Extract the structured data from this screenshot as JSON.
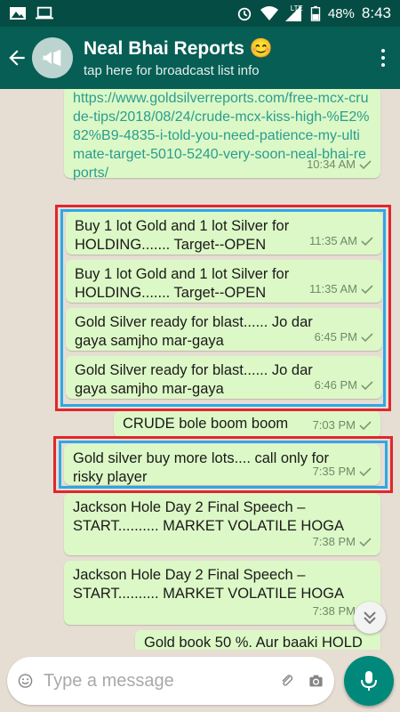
{
  "status_bar": {
    "battery": "48%",
    "time": "8:43",
    "network": "LTE"
  },
  "header": {
    "title": "Neal Bhai Reports 😊",
    "subtitle": "tap here for broadcast list info"
  },
  "messages": [
    {
      "text": "https://www.goldsilverreports.com/free-mcx-crude-tips/2018/08/24/crude-mcx-kiss-high-%E2%82%B9-4835-i-told-you-need-patience-my-ultimate-target-5010-5240-very-soon-neal-bhai-reports/",
      "time": "10:34 AM"
    },
    {
      "text": "Buy 1 lot Gold and 1 lot Silver for HOLDING....... Target--OPEN",
      "time": "11:35 AM"
    },
    {
      "text": "Buy 1 lot Gold and 1 lot Silver for HOLDING....... Target--OPEN",
      "time": "11:35 AM"
    },
    {
      "text": "Gold Silver ready for blast...... Jo dar gaya samjho mar-gaya",
      "time": "6:45 PM"
    },
    {
      "text": "Gold Silver ready for blast...... Jo dar gaya samjho mar-gaya",
      "time": "6:46 PM"
    },
    {
      "text": "CRUDE bole boom boom",
      "time": "7:03 PM"
    },
    {
      "text": "Gold silver buy more lots.... call only for risky player",
      "time": "7:35 PM"
    },
    {
      "text": "Jackson Hole Day 2 Final Speech – START.......... MARKET VOLATILE HOGA",
      "time": "7:38 PM"
    },
    {
      "text": "Jackson Hole Day 2 Final Speech – START.......... MARKET VOLATILE HOGA",
      "time": "7:38 PM"
    },
    {
      "text": "Gold book 50 %. Aur baaki HOLD",
      "time": ""
    }
  ],
  "composer": {
    "placeholder": "Type a message"
  },
  "icons": {
    "back": "arrow-left-icon",
    "avatar": "megaphone-icon",
    "menu": "more-vert-icon",
    "emoji": "emoji-icon",
    "attach": "paperclip-icon",
    "camera": "camera-icon",
    "mic": "mic-icon",
    "scroll": "double-chevron-down-icon"
  },
  "colors": {
    "appbar": "#075e54",
    "statusbar": "#054d44",
    "bubble": "#dcf8c6",
    "highlight_red": "#e1262e",
    "highlight_blue": "#2ea8e4",
    "mic": "#00897b"
  }
}
